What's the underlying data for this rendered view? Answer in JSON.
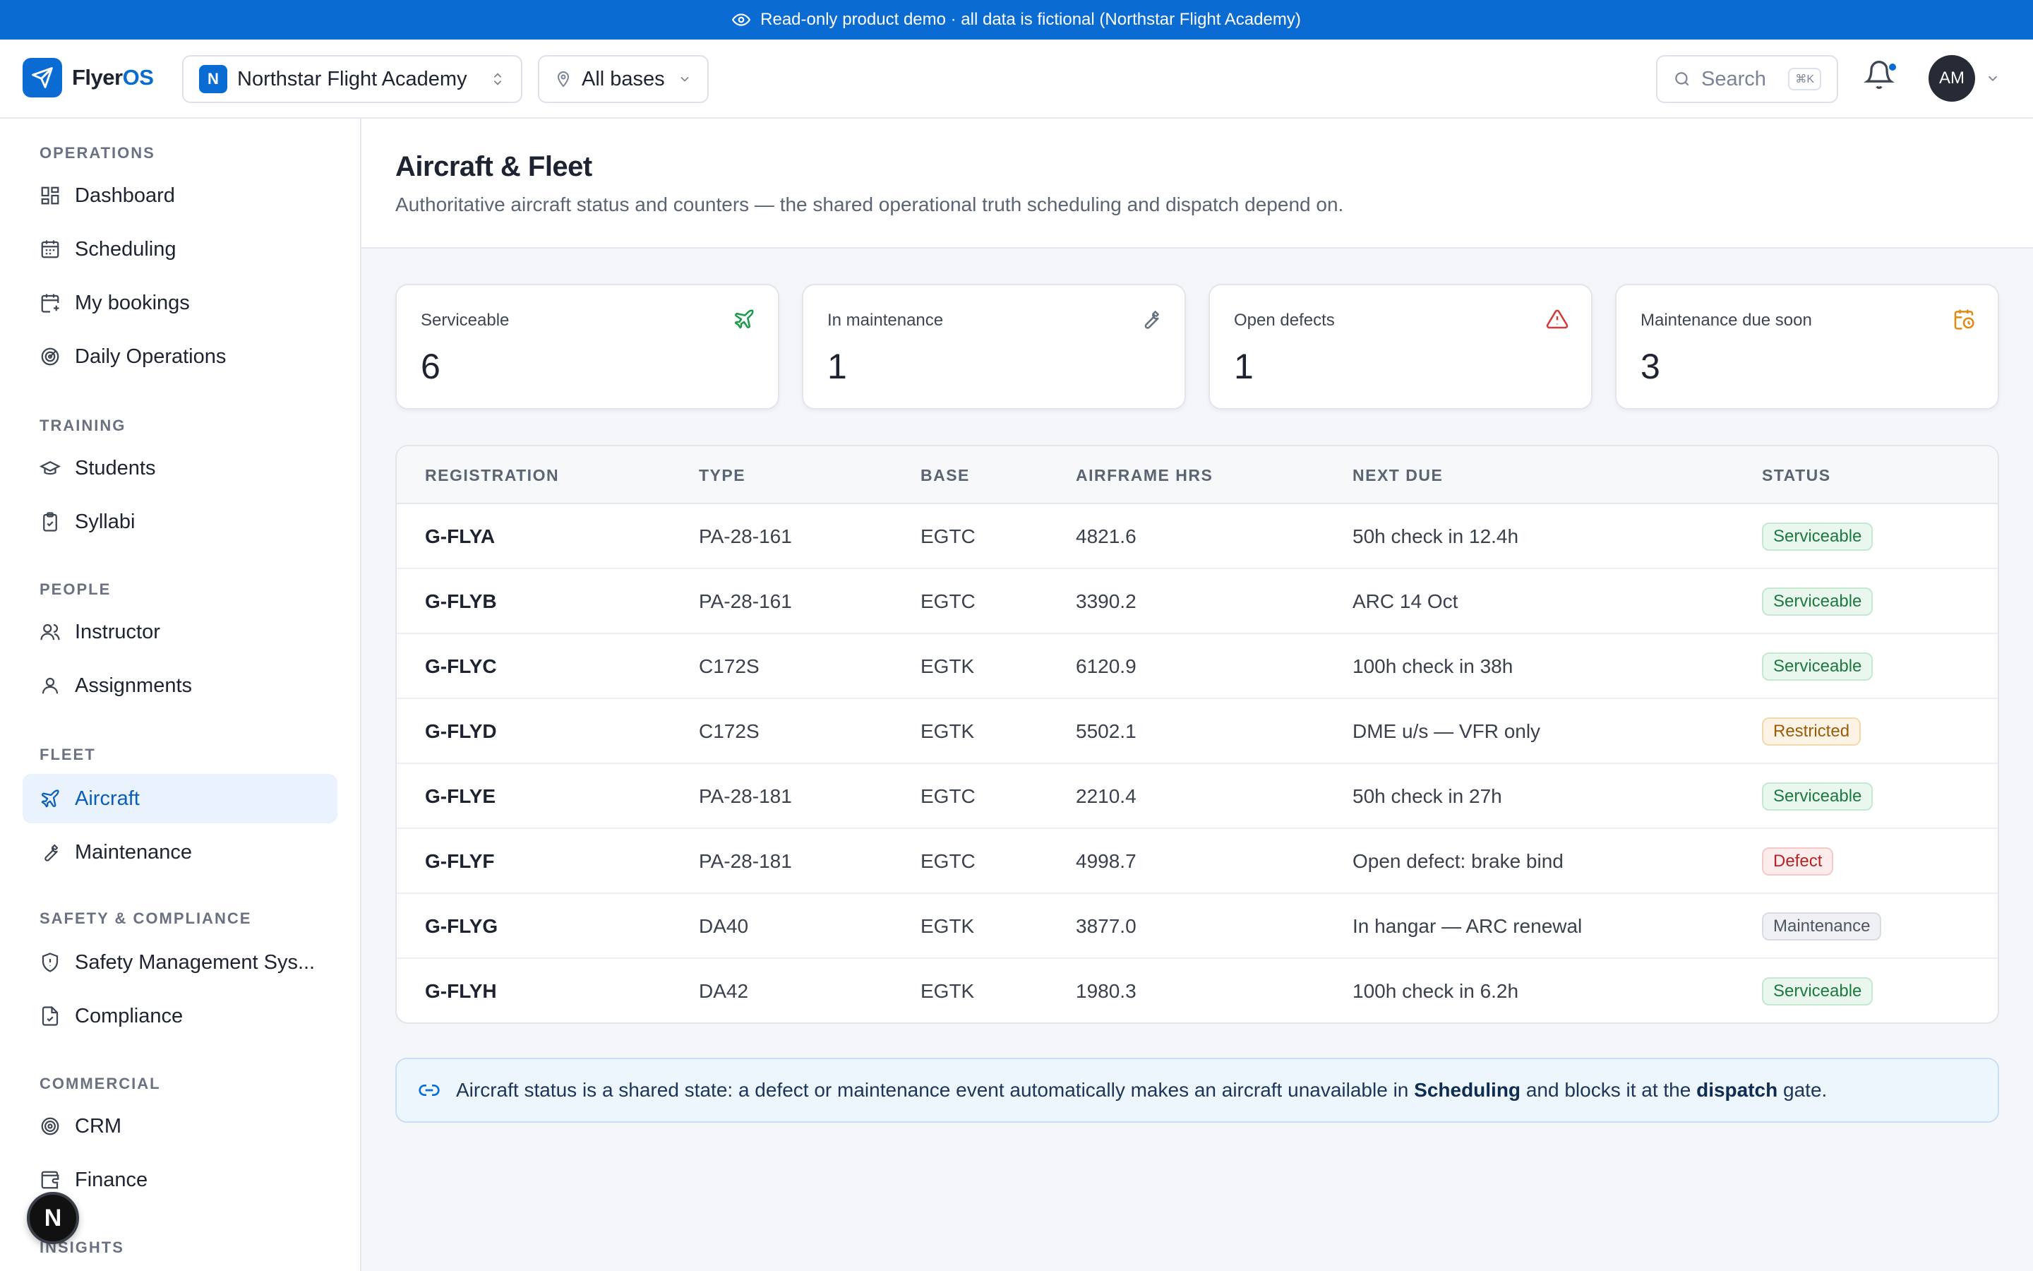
{
  "banner": {
    "text": "Read-only product demo · all data is fictional (Northstar Flight Academy)"
  },
  "app": {
    "name_part1": "Flyer",
    "name_part2": "OS"
  },
  "header": {
    "org_initial": "N",
    "org_name": "Northstar Flight Academy",
    "bases_label": "All bases",
    "search_placeholder": "Search",
    "search_shortcut": "⌘K",
    "avatar_initials": "AM"
  },
  "sidebar": {
    "sections": [
      {
        "title": "OPERATIONS",
        "items": [
          {
            "label": "Dashboard",
            "icon": "dashboard-icon"
          },
          {
            "label": "Scheduling",
            "icon": "calendar-icon"
          },
          {
            "label": "My bookings",
            "icon": "calendar-plus-icon"
          },
          {
            "label": "Daily Operations",
            "icon": "radar-icon"
          }
        ]
      },
      {
        "title": "TRAINING",
        "items": [
          {
            "label": "Students",
            "icon": "graduation-cap-icon"
          },
          {
            "label": "Syllabi",
            "icon": "clipboard-check-icon"
          }
        ]
      },
      {
        "title": "PEOPLE",
        "items": [
          {
            "label": "Instructor",
            "icon": "users-icon"
          },
          {
            "label": "Assignments",
            "icon": "user-icon"
          }
        ]
      },
      {
        "title": "FLEET",
        "items": [
          {
            "label": "Aircraft",
            "icon": "plane-icon",
            "active": true
          },
          {
            "label": "Maintenance",
            "icon": "wrench-icon"
          }
        ]
      },
      {
        "title": "SAFETY & COMPLIANCE",
        "items": [
          {
            "label": "Safety Management Sys...",
            "icon": "shield-icon"
          },
          {
            "label": "Compliance",
            "icon": "file-check-icon"
          }
        ]
      },
      {
        "title": "COMMERCIAL",
        "items": [
          {
            "label": "CRM",
            "icon": "target-icon"
          },
          {
            "label": "Finance",
            "icon": "wallet-icon"
          }
        ]
      },
      {
        "title": "INSIGHTS",
        "items": []
      }
    ],
    "fab_label": "N"
  },
  "page": {
    "title": "Aircraft & Fleet",
    "subtitle": "Authoritative aircraft status and counters — the shared operational truth scheduling and dispatch depend on."
  },
  "stats": [
    {
      "label": "Serviceable",
      "value": "6",
      "icon": "plane-icon",
      "color": "#1b9a4b"
    },
    {
      "label": "In maintenance",
      "value": "1",
      "icon": "wrench-icon",
      "color": "#6a7282"
    },
    {
      "label": "Open defects",
      "value": "1",
      "icon": "alert-triangle-icon",
      "color": "#d43a3a"
    },
    {
      "label": "Maintenance due soon",
      "value": "3",
      "icon": "calendar-clock-icon",
      "color": "#e08a12"
    }
  ],
  "table": {
    "columns": [
      "REGISTRATION",
      "TYPE",
      "BASE",
      "AIRFRAME HRS",
      "NEXT DUE",
      "STATUS"
    ],
    "rows": [
      {
        "registration": "G-FLYA",
        "type": "PA-28-161",
        "base": "EGTC",
        "hours": "4821.6",
        "next_due": "50h check in 12.4h",
        "status": "Serviceable",
        "status_kind": "ok"
      },
      {
        "registration": "G-FLYB",
        "type": "PA-28-161",
        "base": "EGTC",
        "hours": "3390.2",
        "next_due": "ARC 14 Oct",
        "status": "Serviceable",
        "status_kind": "ok"
      },
      {
        "registration": "G-FLYC",
        "type": "C172S",
        "base": "EGTK",
        "hours": "6120.9",
        "next_due": "100h check in 38h",
        "status": "Serviceable",
        "status_kind": "ok"
      },
      {
        "registration": "G-FLYD",
        "type": "C172S",
        "base": "EGTK",
        "hours": "5502.1",
        "next_due": "DME u/s — VFR only",
        "status": "Restricted",
        "status_kind": "res"
      },
      {
        "registration": "G-FLYE",
        "type": "PA-28-181",
        "base": "EGTC",
        "hours": "2210.4",
        "next_due": "50h check in 27h",
        "status": "Serviceable",
        "status_kind": "ok"
      },
      {
        "registration": "G-FLYF",
        "type": "PA-28-181",
        "base": "EGTC",
        "hours": "4998.7",
        "next_due": "Open defect: brake bind",
        "status": "Defect",
        "status_kind": "def"
      },
      {
        "registration": "G-FLYG",
        "type": "DA40",
        "base": "EGTK",
        "hours": "3877.0",
        "next_due": "In hangar — ARC renewal",
        "status": "Maintenance",
        "status_kind": "mnt"
      },
      {
        "registration": "G-FLYH",
        "type": "DA42",
        "base": "EGTK",
        "hours": "1980.3",
        "next_due": "100h check in 6.2h",
        "status": "Serviceable",
        "status_kind": "ok"
      }
    ]
  },
  "note": {
    "text_1": "Aircraft status is a shared state: a defect or maintenance event automatically makes an aircraft unavailable in ",
    "link_1": "Scheduling",
    "text_2": " and blocks it at the ",
    "link_2": "dispatch",
    "text_3": " gate."
  }
}
